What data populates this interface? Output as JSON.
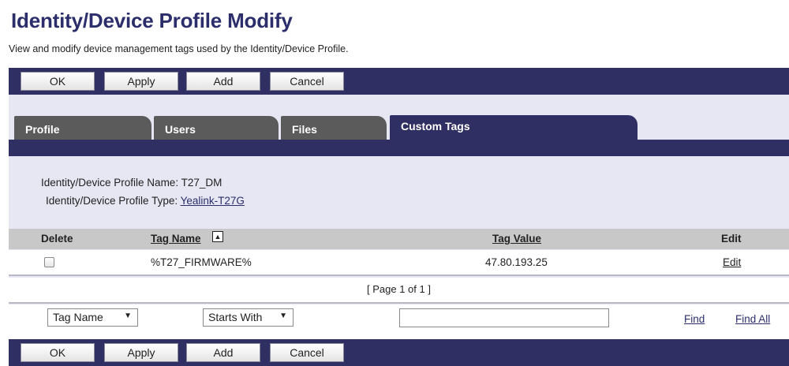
{
  "page": {
    "title": "Identity/Device Profile Modify",
    "description": "View and modify device management tags used by the Identity/Device Profile."
  },
  "toolbar": {
    "ok_label": "OK",
    "apply_label": "Apply",
    "add_label": "Add",
    "cancel_label": "Cancel"
  },
  "tabs": [
    {
      "label": "Profile",
      "active": false
    },
    {
      "label": "Users",
      "active": false
    },
    {
      "label": "Files",
      "active": false
    },
    {
      "label": "Custom Tags",
      "active": true
    }
  ],
  "profile_info": {
    "name_label": "Identity/Device Profile Name:",
    "name_value": "T27_DM",
    "type_label": "Identity/Device Profile Type:",
    "type_value": "Yealink-T27G"
  },
  "table": {
    "headers": {
      "delete": "Delete",
      "tag_name": "Tag Name",
      "tag_value": "Tag Value",
      "edit": "Edit"
    },
    "sort_icon": "sort-ascending-icon",
    "rows": [
      {
        "checked": false,
        "tag_name": "%T27_FIRMWARE%",
        "tag_value": "47.80.193.25",
        "edit_label": "Edit"
      }
    ],
    "pager": "[ Page 1 of 1 ]"
  },
  "filter": {
    "field_selected": "Tag Name",
    "operator_selected": "Starts With",
    "search_value": "",
    "find_label": "Find",
    "find_all_label": "Find All"
  },
  "colors": {
    "navy": "#2f2f63",
    "panel": "#e6e7f3",
    "inactive_tab": "#5b5b5b",
    "title": "#2b2e6b"
  }
}
